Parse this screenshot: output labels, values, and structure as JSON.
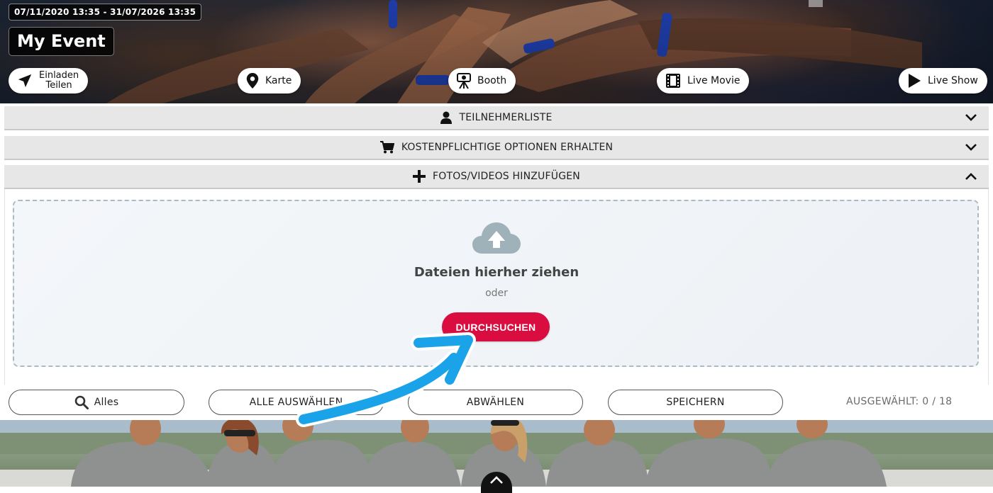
{
  "header": {
    "date_range": "07/11/2020 13:35 - 31/07/2026 13:35",
    "event_title": "My Event",
    "actions": [
      {
        "label_line1": "Einladen",
        "label_line2": "Teilen",
        "icon": "send-icon"
      },
      {
        "label": "Karte",
        "icon": "map-pin-icon"
      },
      {
        "label": "Booth",
        "icon": "camera-booth-icon"
      },
      {
        "label": "Live Movie",
        "icon": "film-icon"
      },
      {
        "label": "Live Show",
        "icon": "play-icon"
      }
    ]
  },
  "accordion": {
    "participants": {
      "label": "TEILNEHMERLISTE",
      "icon": "user-icon",
      "expanded": false
    },
    "paid_options": {
      "label": "KOSTENPFLICHTIGE OPTIONEN ERHALTEN",
      "icon": "cart-icon",
      "expanded": false
    },
    "add_media": {
      "label": "FOTOS/VIDEOS HINZUFÜGEN",
      "icon": "plus-icon",
      "expanded": true
    }
  },
  "dropzone": {
    "icon": "cloud-upload-icon",
    "title": "Dateien hierher ziehen",
    "or_text": "oder",
    "browse_label": "DURCHSUCHEN"
  },
  "toolbar": {
    "filter_label": "Alles",
    "select_all_label": "ALLE AUSWÄHLEN",
    "deselect_label": "ABWÄHLEN",
    "save_label": "SPEICHERN",
    "selected_count": "AUSGEWÄHLT: 0 / 18"
  },
  "colors": {
    "accent_red": "#d90d3f",
    "annotation_arrow": "#1aa3e8",
    "accordion_bg": "#e7e7e7"
  }
}
